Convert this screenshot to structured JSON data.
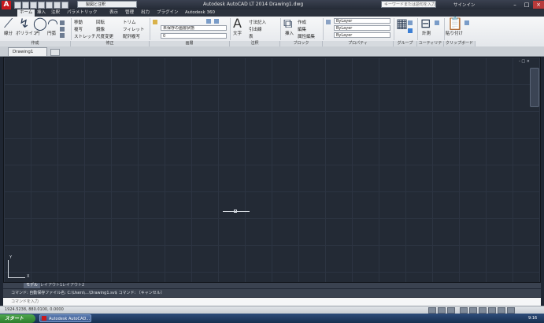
{
  "app": {
    "title": "Autodesk AutoCAD LT 2014   Drawing1.dwg",
    "logo_letter": "A",
    "workspace": "製図と注釈",
    "help_search_placeholder": "キーワードまたは語句を入力",
    "signin_label": "サインイン"
  },
  "ribbon": {
    "tabs": [
      "ホーム",
      "挿入",
      "注釈",
      "パラメトリック",
      "表示",
      "管理",
      "出力",
      "プラグイン",
      "Autodesk 360"
    ],
    "active_tab": "ホーム",
    "panels": [
      "作成",
      "修正",
      "画層",
      "注釈",
      "ブロック",
      "プロパティ",
      "グループ",
      "ユーティリティ",
      "クリップボード"
    ],
    "draw_tools": [
      "線分",
      "ポリライン",
      "円",
      "円弧"
    ],
    "modify_tools": [
      "移動",
      "回転",
      "トリム",
      "複写",
      "鏡像",
      "フィレット",
      "ストレッチ",
      "尺度変更",
      "配列複写"
    ],
    "layer_current": "0",
    "layer_state": "未保存の画層状態",
    "annotation_tools": [
      "文字",
      "寸法記入",
      "引出線",
      "表"
    ],
    "block_tools": [
      "挿入",
      "作成",
      "編集",
      "属性編集"
    ],
    "properties": {
      "color": "ByLayer",
      "lineweight": "ByLayer",
      "linetype": "ByLayer"
    },
    "utility_tools": [
      "計測"
    ],
    "clipboard_tools": [
      "貼り付け"
    ]
  },
  "file_tab": {
    "label": "Drawing1"
  },
  "canvas": {
    "controls": "- □ ×",
    "ucs_x": "X",
    "ucs_y": "Y"
  },
  "layout_tabs": [
    "モデル",
    "レイアウト1",
    "レイアウト2"
  ],
  "command": {
    "history": "コマンド: 自動保存ファイル名: C:\\Users\\...\\Drawing1.sv$   コマンド: 〔キャンセル〕",
    "input_placeholder": "コマンドを入力"
  },
  "status": {
    "coordinates": "1924.5238, 880.0100, 0.0000"
  },
  "taskbar": {
    "start_label": "スタート",
    "task_label": "Autodesk AutoCAD...",
    "clock": "9:16"
  },
  "colors": {
    "canvas_bg": "#232a35",
    "grid": "#2c3442",
    "accent": "#c8191e"
  }
}
